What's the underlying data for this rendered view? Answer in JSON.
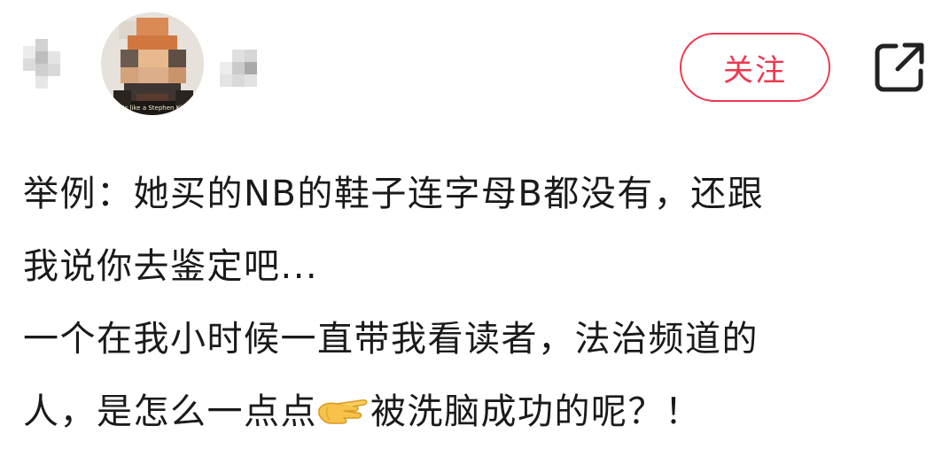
{
  "header": {
    "follow_label": "关注"
  },
  "avatar": {
    "caption": "It's like a Stephen King"
  },
  "post": {
    "line1": "举例：她买的NB的鞋子连字母B都没有，还跟",
    "line2": "我说你去鉴定吧...",
    "line3": "一个在我小时候一直带我看读者，法治频道的",
    "line4_before": "人，是怎么一点点",
    "line4_after": "被洗脑成功的呢？！"
  },
  "icons": {
    "share": "share-external-icon",
    "hand": "pinching-hand-emoji-icon"
  },
  "colors": {
    "accent": "#ea3a4f",
    "text": "#1a1a1a"
  }
}
